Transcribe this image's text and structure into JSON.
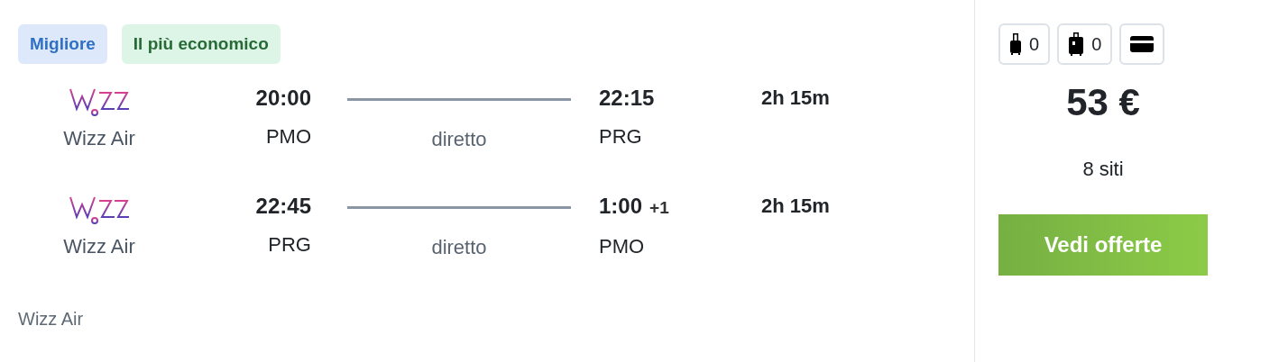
{
  "badges": [
    {
      "label": "Migliore",
      "kind": "best"
    },
    {
      "label": "Il più economico",
      "kind": "cheapest"
    }
  ],
  "legs": [
    {
      "airline": "Wizz Air",
      "depart_time": "20:00",
      "depart_airport": "PMO",
      "stops": "diretto",
      "arrive_time": "22:15",
      "arrive_airport": "PRG",
      "duration": "2h 15m"
    },
    {
      "airline": "Wizz Air",
      "depart_time": "22:45",
      "depart_airport": "PRG",
      "stops": "diretto",
      "arrive_time": "1:00",
      "day_offset": "+1",
      "arrive_airport": "PMO",
      "duration": "2h 15m"
    }
  ],
  "operator": "Wizz Air",
  "extras": [
    {
      "kind": "cabin-bag",
      "count": "0"
    },
    {
      "kind": "checked-bag",
      "count": "0"
    },
    {
      "kind": "card"
    }
  ],
  "price": "53 €",
  "sites": "8 siti",
  "cta": "Vedi offerte"
}
